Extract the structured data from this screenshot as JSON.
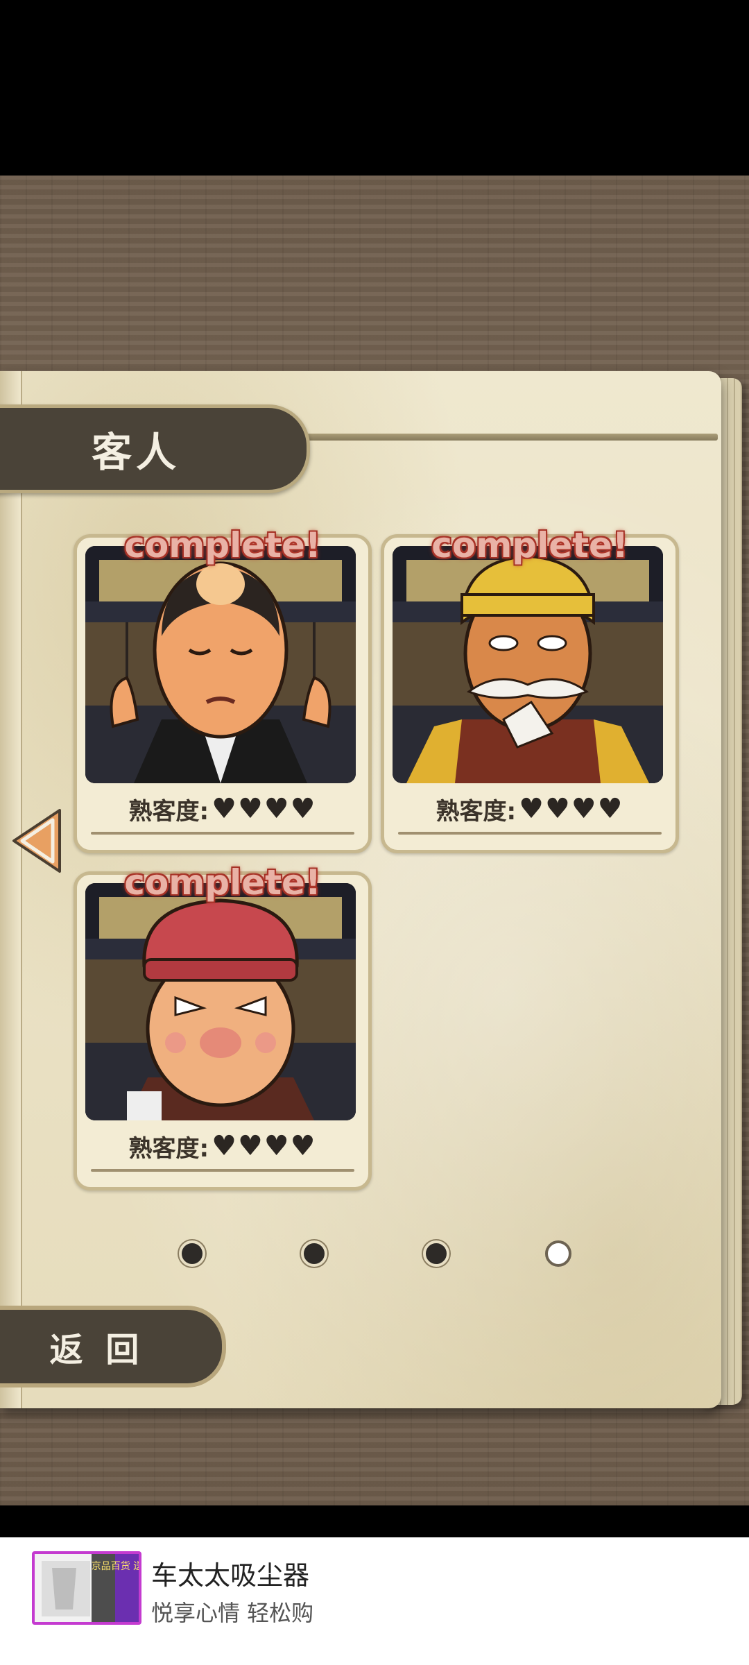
{
  "page": {
    "title": "客人"
  },
  "cards": [
    {
      "badge": "complete!",
      "label": "熟客度:",
      "hearts": "♥♥♥♥",
      "character": "bald-businessman"
    },
    {
      "badge": "complete!",
      "label": "熟客度:",
      "hearts": "♥♥♥♥",
      "character": "old-man-yellow-cap"
    },
    {
      "badge": "complete!",
      "label": "熟客度:",
      "hearts": "♥♥♥♥",
      "character": "man-red-cap"
    }
  ],
  "pagination": {
    "total": 4,
    "current": 4
  },
  "buttons": {
    "back": "返 回",
    "prev_icon": "triangle-left-icon"
  },
  "ad": {
    "title": "车太太吸尘器",
    "subtitle": "悦享心情 轻松购",
    "thumb_text": "京品百货 送到家"
  },
  "colors": {
    "tab": "#4a4338",
    "paper": "#efe8cf",
    "complete": "#e9b2a6",
    "arrow": "#e8a062"
  }
}
